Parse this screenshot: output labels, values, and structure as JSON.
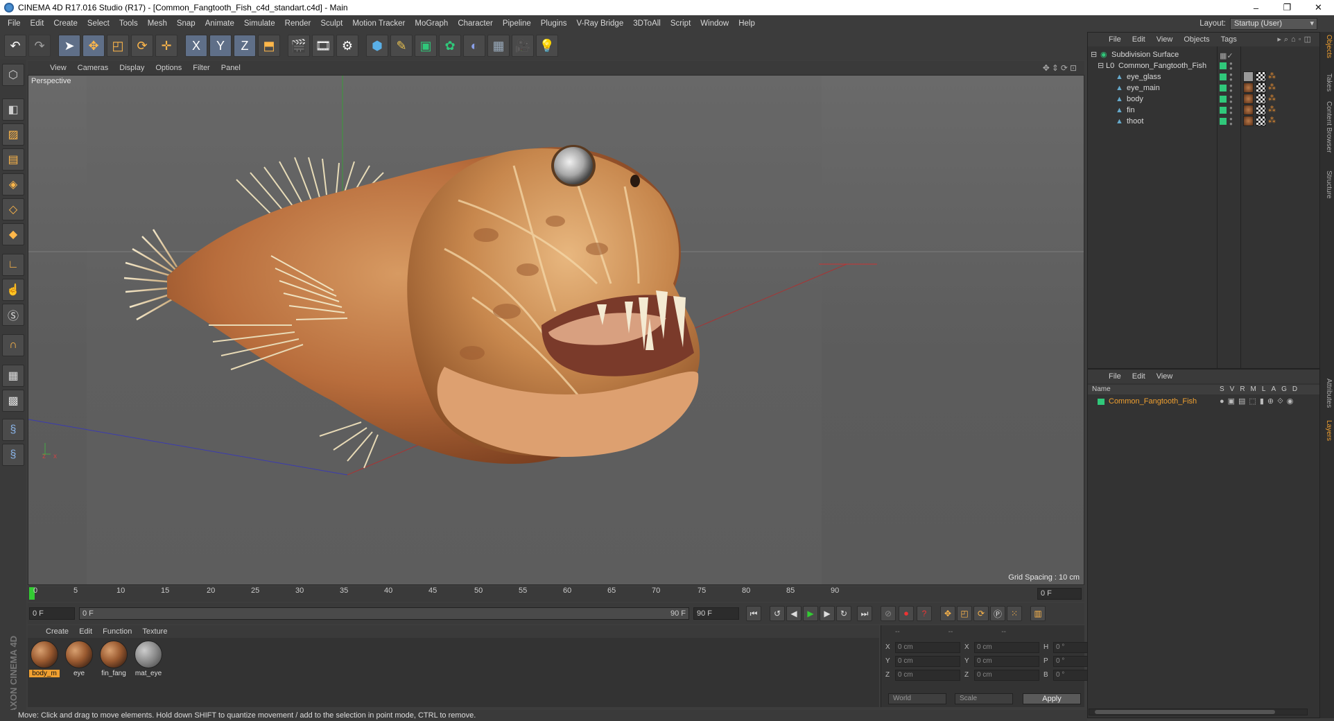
{
  "window": {
    "title": "CINEMA 4D R17.016 Studio (R17) - [Common_Fangtooth_Fish_c4d_standart.c4d] - Main",
    "controls": [
      "–",
      "❐",
      "✕"
    ]
  },
  "menubar": [
    "File",
    "Edit",
    "Create",
    "Select",
    "Tools",
    "Mesh",
    "Snap",
    "Animate",
    "Simulate",
    "Render",
    "Sculpt",
    "Motion Tracker",
    "MoGraph",
    "Character",
    "Pipeline",
    "Plugins",
    "V-Ray Bridge",
    "3DToAll",
    "Script",
    "Window",
    "Help"
  ],
  "layout": {
    "label": "Layout:",
    "value": "Startup (User)"
  },
  "toolbar": {
    "icons": [
      "undo-icon",
      "redo-icon",
      "select-arrow-icon",
      "move-icon",
      "scale-icon",
      "rotate-icon",
      "live-move-icon",
      "x-axis-icon",
      "y-axis-icon",
      "z-axis-icon",
      "coordinate-system-icon",
      "render-view-icon",
      "render-picture-icon",
      "render-settings-icon",
      "cube-icon",
      "pen-icon",
      "subdivision-icon",
      "cloner-icon",
      "deformer-icon",
      "floor-icon",
      "camera-icon",
      "light-icon"
    ],
    "axis_labels": [
      "X",
      "Y",
      "Z"
    ]
  },
  "viewport": {
    "menu": [
      "View",
      "Cameras",
      "Display",
      "Options",
      "Filter",
      "Panel"
    ],
    "label": "Perspective",
    "grid_spacing": "Grid Spacing : 10 cm"
  },
  "timeline": {
    "ticks": [
      "0",
      "5",
      "10",
      "15",
      "20",
      "25",
      "30",
      "35",
      "40",
      "45",
      "50",
      "55",
      "60",
      "65",
      "70",
      "75",
      "80",
      "85",
      "90"
    ],
    "current_frame_field": "0 F",
    "end_frame": "0 F"
  },
  "playback": {
    "start_field": "0 F",
    "range_start": "0 F",
    "range_end": "90 F",
    "end_field": "90 F"
  },
  "material_manager": {
    "menu": [
      "Create",
      "Edit",
      "Function",
      "Texture"
    ],
    "materials": [
      {
        "name": "body_m",
        "selected": true,
        "style": "brown"
      },
      {
        "name": "eye",
        "selected": false,
        "style": "brown"
      },
      {
        "name": "fin_fang",
        "selected": false,
        "style": "brown"
      },
      {
        "name": "mat_eye",
        "selected": false,
        "style": "gray"
      }
    ]
  },
  "coordinates": {
    "header": [
      "--",
      "--",
      "--"
    ],
    "rows": [
      {
        "a": "X",
        "av": "0 cm",
        "b": "X",
        "bv": "0 cm",
        "c": "H",
        "cv": "0 °"
      },
      {
        "a": "Y",
        "av": "0 cm",
        "b": "Y",
        "bv": "0 cm",
        "c": "P",
        "cv": "0 °"
      },
      {
        "a": "Z",
        "av": "0 cm",
        "b": "Z",
        "bv": "0 cm",
        "c": "B",
        "cv": "0 °"
      }
    ],
    "mode1": "World",
    "mode2": "Scale",
    "apply": "Apply"
  },
  "object_manager": {
    "menu": [
      "File",
      "Edit",
      "View",
      "Objects",
      "Tags"
    ],
    "objects": [
      {
        "name": "Subdivision Surface",
        "level": 0,
        "icon": "subdivision-icon"
      },
      {
        "name": "Common_Fangtooth_Fish",
        "level": 1,
        "icon": "null-icon"
      },
      {
        "name": "eye_glass",
        "level": 2,
        "icon": "polygon-icon",
        "tags": [
          "gry",
          "chk",
          "ph"
        ]
      },
      {
        "name": "eye_main",
        "level": 2,
        "icon": "polygon-icon",
        "tags": [
          "mat1",
          "chk",
          "ph"
        ]
      },
      {
        "name": "body",
        "level": 2,
        "icon": "polygon-icon",
        "tags": [
          "mat1",
          "chk",
          "ph"
        ]
      },
      {
        "name": "fin",
        "level": 2,
        "icon": "polygon-icon",
        "tags": [
          "mat1",
          "chk",
          "ph"
        ]
      },
      {
        "name": "thoot",
        "level": 2,
        "icon": "polygon-icon",
        "tags": [
          "mat1",
          "chk",
          "ph"
        ]
      }
    ]
  },
  "layer_manager": {
    "menu": [
      "File",
      "Edit",
      "View"
    ],
    "header_name": "Name",
    "header_cols": "SVRMLAGD",
    "layers": [
      {
        "name": "Common_Fangtooth_Fish",
        "color": "#30c87a"
      }
    ]
  },
  "right_tabs": [
    "Objects",
    "Takes",
    "Content Browser",
    "Structure",
    "Attributes",
    "Layers"
  ],
  "status": "Move: Click and drag to move elements. Hold down SHIFT to quantize movement / add to the selection in point mode, CTRL to remove.",
  "brand": "MAXON CINEMA 4D",
  "colors": {
    "accent": "#f0a030",
    "layer_green": "#30c87a",
    "selection_blue": "#5f6f88"
  }
}
